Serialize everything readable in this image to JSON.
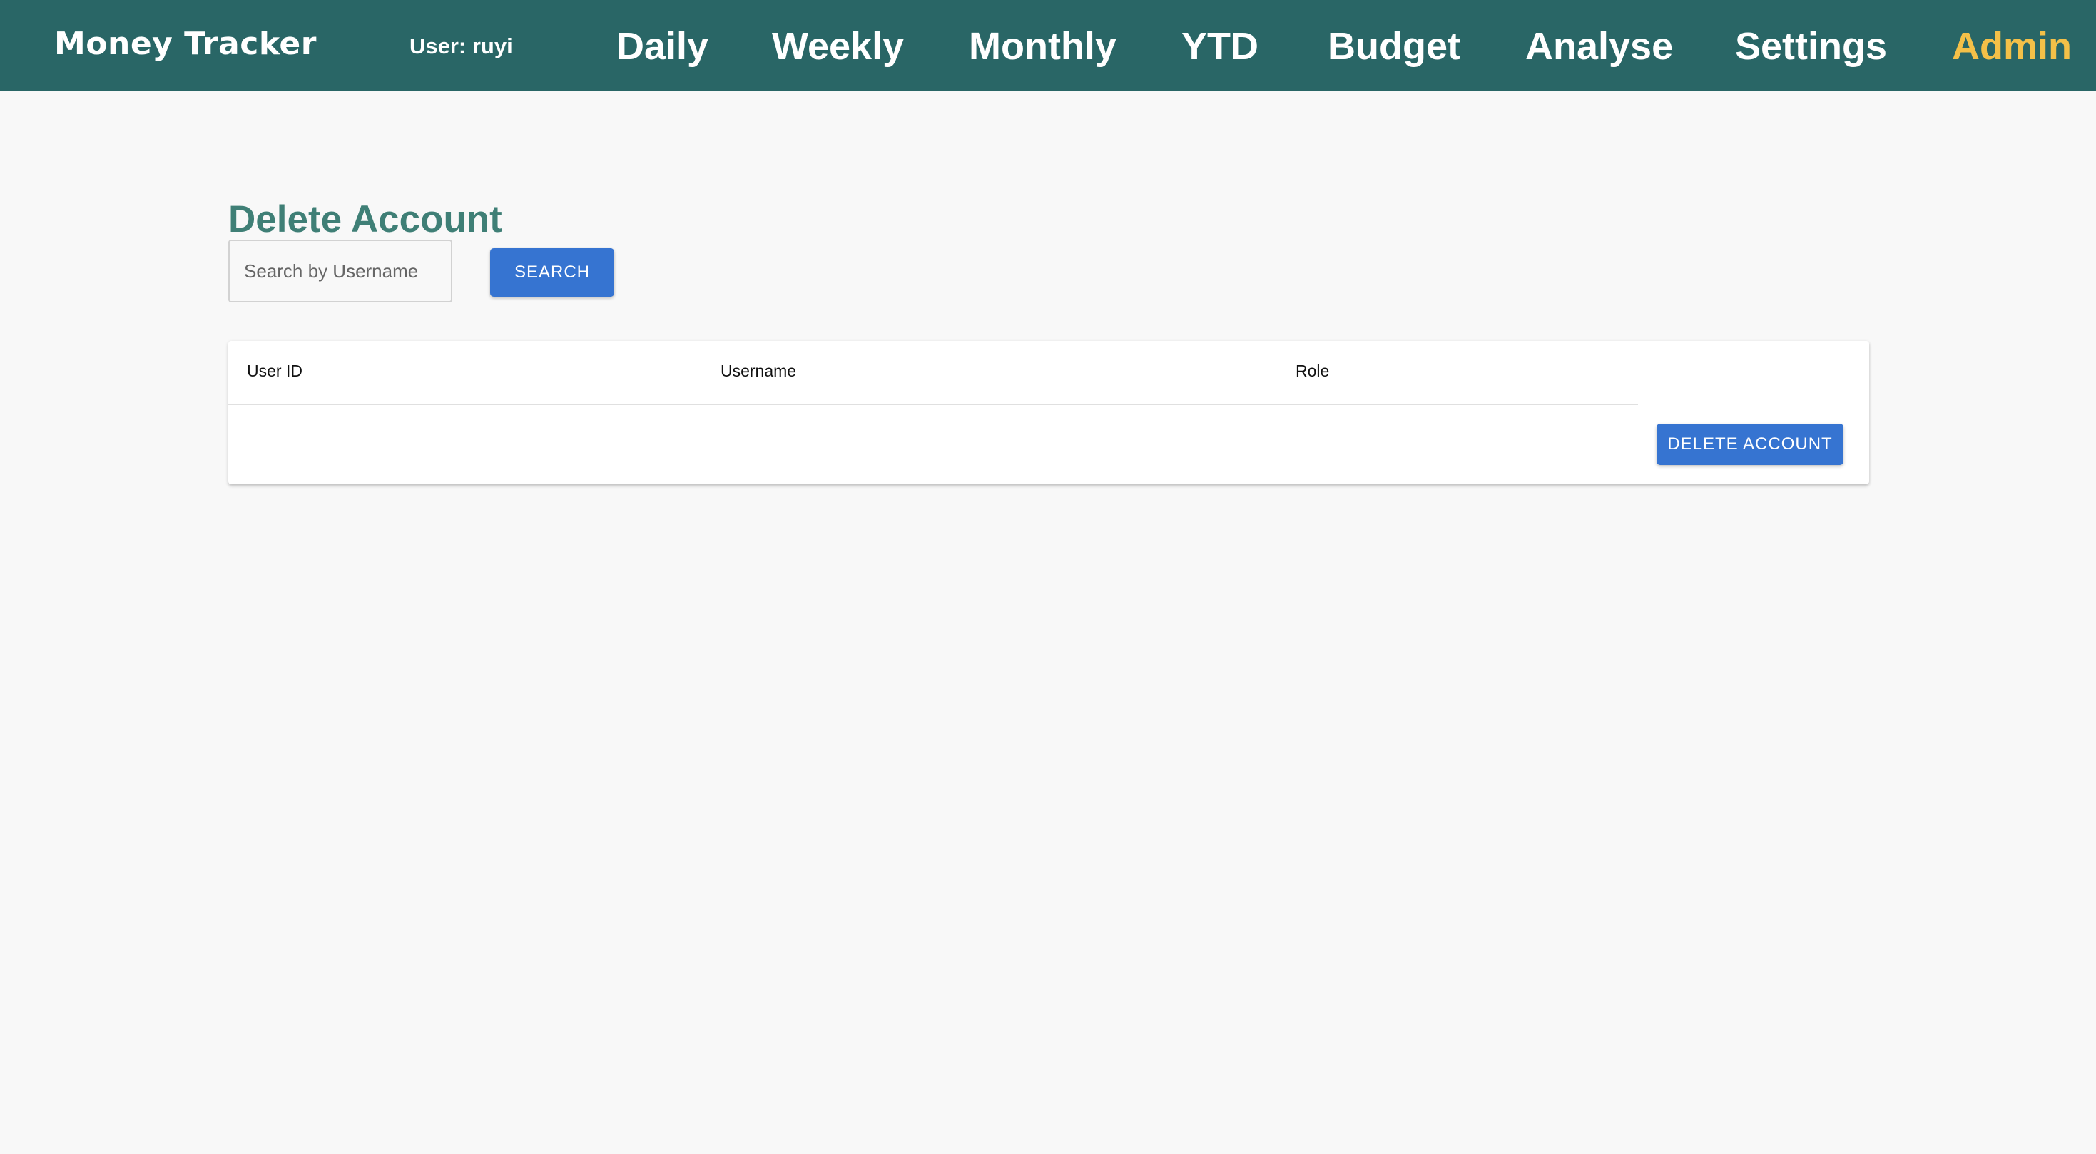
{
  "navbar": {
    "brand": "Money Tracker",
    "user_label": "User: ruyi",
    "items": [
      {
        "label": "Daily",
        "active": false
      },
      {
        "label": "Weekly",
        "active": false
      },
      {
        "label": "Monthly",
        "active": false
      },
      {
        "label": "YTD",
        "active": false
      },
      {
        "label": "Budget",
        "active": false
      },
      {
        "label": "Analyse",
        "active": false
      },
      {
        "label": "Settings",
        "active": false
      },
      {
        "label": "Admin",
        "active": true
      }
    ]
  },
  "page": {
    "title": "Delete Account"
  },
  "search": {
    "placeholder": "Search by Username",
    "value": "",
    "button_label": "SEARCH"
  },
  "table": {
    "columns": [
      "User ID",
      "Username",
      "Role"
    ],
    "rows": [],
    "delete_button_label": "DELETE ACCOUNT"
  },
  "colors": {
    "navbar_bg": "#296666",
    "active_nav": "#f4c048",
    "title": "#3f7f76",
    "primary_button": "#3674d1",
    "page_bg": "#f8f8f8"
  }
}
